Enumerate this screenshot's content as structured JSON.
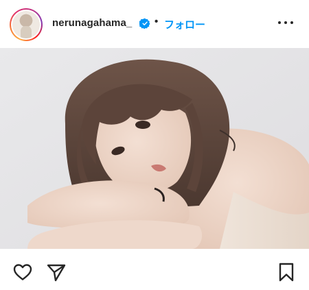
{
  "post": {
    "username": "nerunagahama_",
    "separator": "•",
    "follow_label": "フォロー",
    "verified": true,
    "accent_color": "#0095f6",
    "verified_color": "#0095f6",
    "photo_alt": ""
  },
  "icons": {
    "more": "more-options-icon",
    "like": "heart-icon",
    "share": "paper-plane-icon",
    "save": "bookmark-icon"
  }
}
